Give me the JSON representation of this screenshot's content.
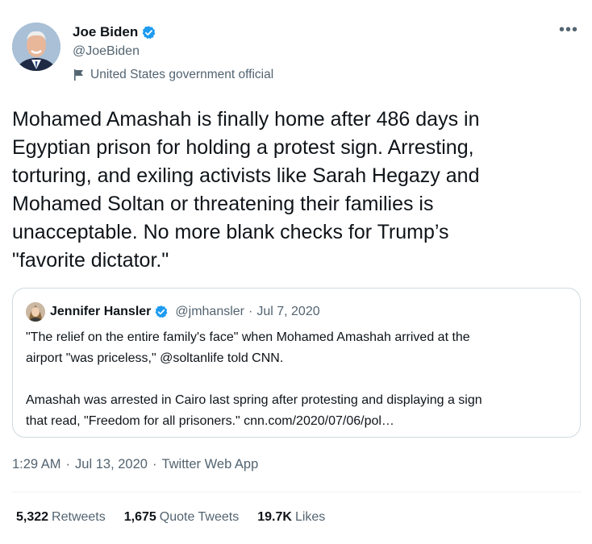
{
  "author": {
    "name": "Joe Biden",
    "handle": "@JoeBiden",
    "label": "United States government official",
    "verified": true
  },
  "tweet": {
    "text": "Mohamed Amashah is finally home after 486 days in\nEgyptian prison for holding a protest sign. Arresting,\ntorturing, and exiling activists like Sarah Hegazy and\nMohamed Soltan or threatening their families is\nunacceptable. No more blank checks for Trump’s\n\"favorite dictator.\""
  },
  "quote": {
    "name": "Jennifer Hansler",
    "handle": "@jmhansler",
    "separator": "·",
    "date": "Jul 7, 2020",
    "text": "\"The relief on the entire family's face\" when Mohamed Amashah arrived at the\nairport \"was priceless,\" @soltanlife told CNN.\n\nAmashah was arrested in Cairo last spring after protesting and displaying a sign\nthat read, \"Freedom for all prisoners.\" cnn.com/2020/07/06/pol…"
  },
  "meta": {
    "time": "1:29 AM",
    "dot": "·",
    "date": "Jul 13, 2020",
    "app": "Twitter Web App"
  },
  "stats": {
    "retweets_count": "5,322",
    "retweets_label": "Retweets",
    "quotes_count": "1,675",
    "quotes_label": "Quote Tweets",
    "likes_count": "19.7K",
    "likes_label": "Likes"
  },
  "colors": {
    "verified_blue": "#1d9bf0",
    "secondary_text": "#536471",
    "primary_text": "#0f1419",
    "border": "#cfd9de"
  },
  "icons": [
    "verified-badge-icon",
    "flag-icon",
    "more-options-icon"
  ]
}
